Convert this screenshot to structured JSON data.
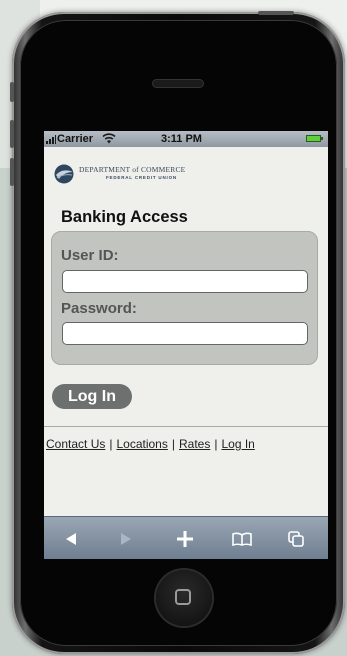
{
  "status_bar": {
    "carrier": "Carrier",
    "time": "3:11 PM"
  },
  "logo": {
    "line1": "DEPARTMENT of COMMERCE",
    "line2": "FEDERAL CREDIT UNION"
  },
  "page": {
    "heading": "Banking Access"
  },
  "form": {
    "user_id_label": "User ID:",
    "user_id_value": "",
    "password_label": "Password:",
    "password_value": "",
    "login_button": "Log In"
  },
  "footer": {
    "links": [
      "Contact Us",
      "Locations",
      "Rates",
      "Log In"
    ],
    "separator": "|"
  },
  "toolbar": {
    "icons": [
      "back-icon",
      "forward-icon",
      "add-icon",
      "bookmarks-icon",
      "pages-icon"
    ]
  },
  "colors": {
    "status_bar": "#9aa3ab",
    "panel": "#c2c4bf",
    "button": "#6c7170",
    "toolbar": "#8594a4",
    "battery": "#5ccf3a"
  }
}
